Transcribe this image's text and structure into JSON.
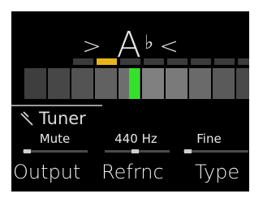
{
  "tuner": {
    "arrow_left": ">",
    "note_letter": "A",
    "note_accidental": "♭",
    "arrow_right": "<",
    "cents_dots": {
      "count": 8,
      "active_index": 1,
      "active_color": "#e7b51a"
    },
    "meter": {
      "segment_colors": [
        "#3e3e3e",
        "#474747",
        "#535353",
        "#616161",
        "#6e6e6e",
        "#808080",
        "#7a7a7a",
        "#6a6a6a",
        "#5a5a5a",
        "#4a4a4a"
      ],
      "indicator_color": "#34e12a",
      "indicator_position": 0.47
    },
    "title": "Tuner",
    "title_icon": "tuning-fork-icon"
  },
  "params": [
    {
      "value": "Mute",
      "label": "Output",
      "level": 0.02
    },
    {
      "value": "440 Hz",
      "label": "Refrnc",
      "level": 0.46
    },
    {
      "value": "Fine",
      "label": "Type",
      "level": 0.02
    }
  ]
}
